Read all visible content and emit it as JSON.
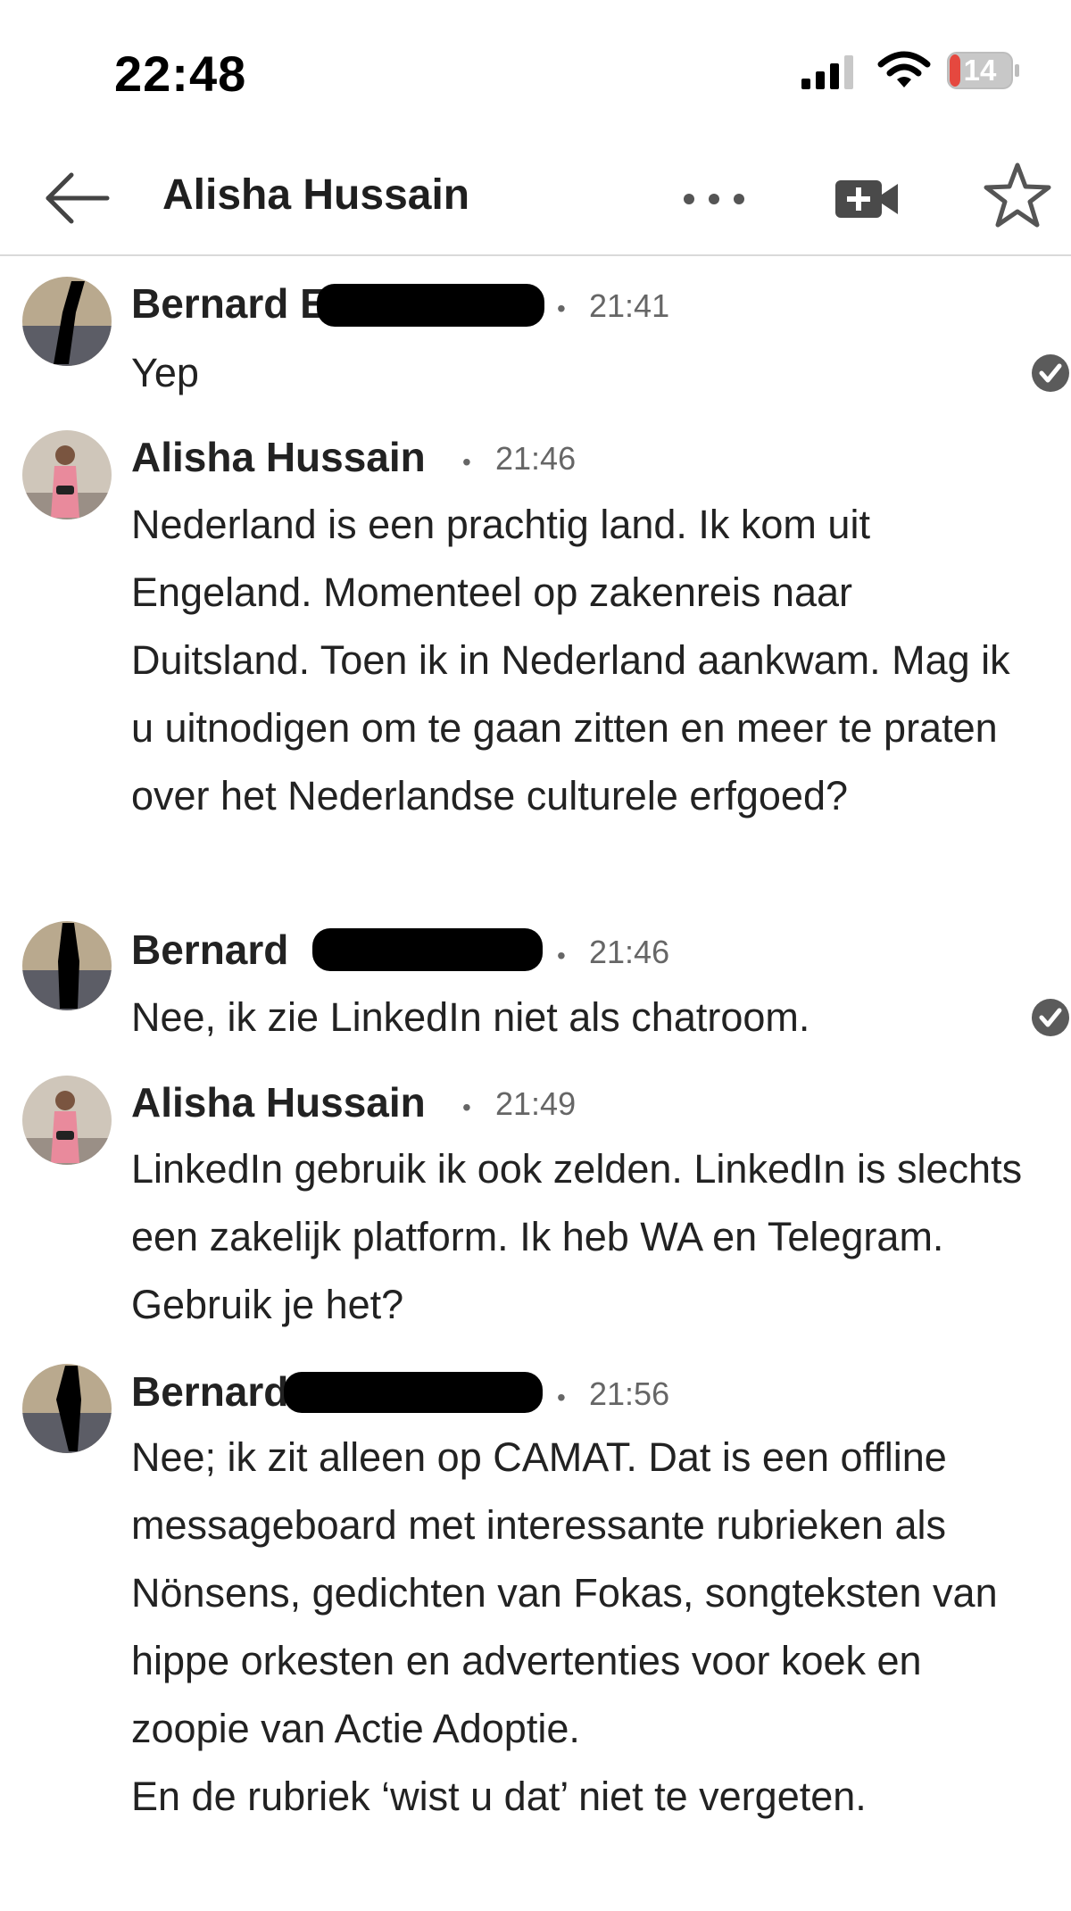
{
  "status_bar": {
    "time": "22:48",
    "battery": "14",
    "battery_color": "#e5483f"
  },
  "header": {
    "title": "Alisha Hussain",
    "back_icon": "arrow-left-icon",
    "more_icon": "more-horizontal-icon",
    "video_icon": "video-add-icon",
    "star_icon": "star-outline-icon"
  },
  "messages": [
    {
      "sender": "Bernard E",
      "time": "21:41",
      "text": [
        "Yep"
      ],
      "read": true
    },
    {
      "sender": "Alisha Hussain",
      "time": "21:46",
      "text": [
        "Nederland is een prachtig land. Ik kom uit Engeland. Momenteel op zakenreis naar Duitsland. Toen ik in Nederland aankwam. Mag ik u uitnodigen om te gaan zitten en meer te praten over het Nederlandse culturele erfgoed?"
      ],
      "read": false
    },
    {
      "sender": "Bernard",
      "time": "21:46",
      "text": [
        "Nee, ik zie LinkedIn niet als chatroom."
      ],
      "read": true
    },
    {
      "sender": "Alisha Hussain",
      "time": "21:49",
      "text": [
        "LinkedIn gebruik ik ook zelden. LinkedIn is slechts een zakelijk platform. Ik heb WA en Telegram. Gebruik je het?"
      ],
      "read": false
    },
    {
      "sender": "Bernard",
      "time": "21:56",
      "text": [
        "Nee; ik zit alleen op CAMAT. Dat is een offline messageboard met interessante rubrieken als Nönsens, gedichten van Fokas, songteksten van hippe orkesten en advertenties voor koek en zoopie van Actie Adoptie.",
        "En de rubriek ‘wist u dat’ niet te vergeten."
      ],
      "read": false
    }
  ]
}
